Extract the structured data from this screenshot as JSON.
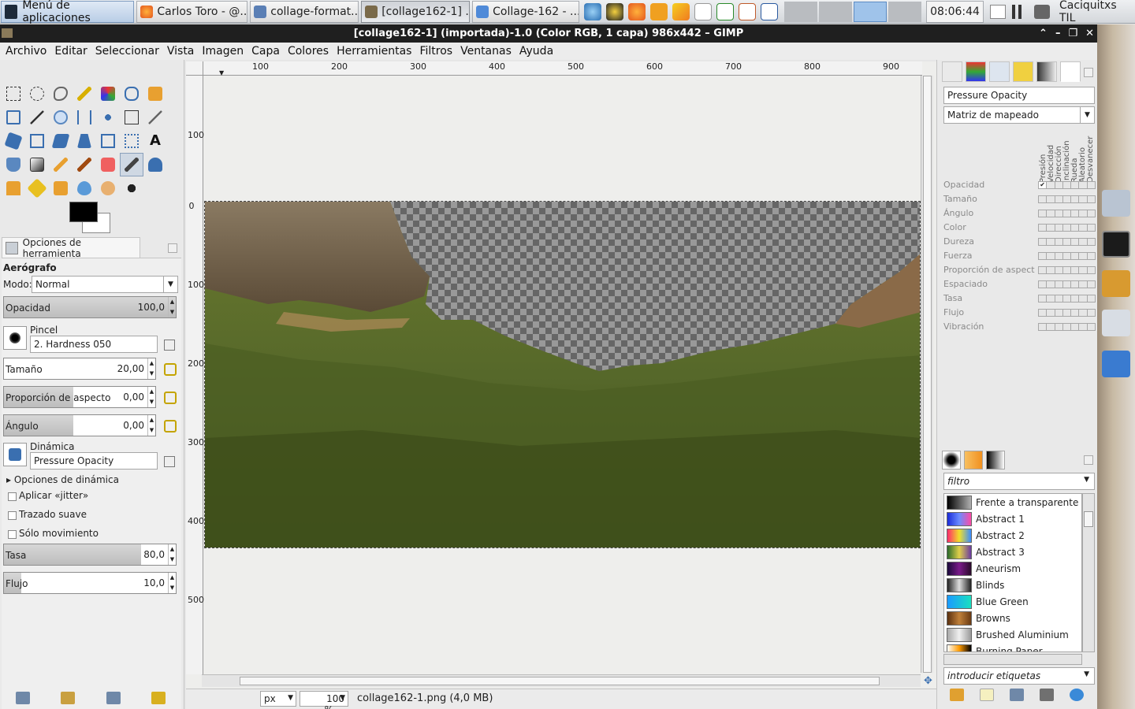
{
  "taskbar": {
    "menu_label": "Menú de aplicaciones",
    "tasks": [
      {
        "label": "Carlos Toro - @..."
      },
      {
        "label": "collage-format..."
      },
      {
        "label": "[collage162-1] ..."
      },
      {
        "label": "Collage-162 - ..."
      }
    ],
    "clock": "08:06:44",
    "user": "Caciquitxs TIL"
  },
  "window": {
    "title": "[collage162-1] (importada)-1.0 (Color RGB, 1 capa) 986x442 – GIMP"
  },
  "menubar": [
    "Archivo",
    "Editar",
    "Seleccionar",
    "Vista",
    "Imagen",
    "Capa",
    "Colores",
    "Herramientas",
    "Filtros",
    "Ventanas",
    "Ayuda"
  ],
  "tool_options": {
    "tab_label": "Opciones de herramienta",
    "tool_name": "Aerógrafo",
    "mode_label": "Modo:",
    "mode_value": "Normal",
    "opacity_label": "Opacidad",
    "opacity_value": "100,0",
    "brush_label": "Pincel",
    "brush_value": "2. Hardness 050",
    "size_label": "Tamaño",
    "size_value": "20,00",
    "aspect_label": "Proporción de aspecto",
    "aspect_value": "0,00",
    "angle_label": "Ángulo",
    "angle_value": "0,00",
    "dynamics_label": "Dinámica",
    "dynamics_value": "Pressure Opacity",
    "dynamics_options_label": "Opciones de dinámica",
    "jitter_label": "Aplicar «jitter»",
    "smooth_label": "Trazado suave",
    "motion_label": "Sólo movimiento",
    "rate_label": "Tasa",
    "rate_value": "80,0",
    "flow_label": "Flujo",
    "flow_value": "10,0"
  },
  "ruler": {
    "h_labels": [
      "100",
      "200",
      "300",
      "400",
      "500",
      "600",
      "700",
      "800",
      "900"
    ],
    "v_labels": [
      "100",
      "0",
      "100",
      "200",
      "300",
      "400",
      "500"
    ]
  },
  "statusbar": {
    "unit": "px",
    "zoom": "100 %",
    "message": "collage162-1.png (4,0 MB)"
  },
  "dynamics_editor": {
    "name": "Pressure Opacity",
    "mode": "Matriz de mapeado",
    "columns": [
      "Presión",
      "Velocidad",
      "Dirección",
      "Inclinación",
      "Rueda",
      "Aleatorio",
      "Desvanecer"
    ],
    "rows": [
      "Opacidad",
      "Tamaño",
      "Ángulo",
      "Color",
      "Dureza",
      "Fuerza",
      "Proporción de aspect",
      "Espaciado",
      "Tasa",
      "Flujo",
      "Vibración"
    ]
  },
  "gradients": {
    "filter_placeholder": "filtro",
    "tags_placeholder": "introducir etiquetas",
    "items": [
      {
        "name": "Frente a transparente",
        "colors": [
          "#000000",
          "#b0b0b0"
        ]
      },
      {
        "name": "Abstract 1",
        "colors": [
          "#1b2bd8",
          "#6a8cff",
          "#ff4aa5"
        ]
      },
      {
        "name": "Abstract 2",
        "colors": [
          "#ff2a6a",
          "#f0e02a",
          "#3a8cff"
        ]
      },
      {
        "name": "Abstract 3",
        "colors": [
          "#2a6a2a",
          "#e0d04a",
          "#6a3aa0"
        ]
      },
      {
        "name": "Aneurism",
        "colors": [
          "#1a0a3a",
          "#7a1a8a",
          "#2a0a2a"
        ]
      },
      {
        "name": "Blinds",
        "colors": [
          "#222222",
          "#dddddd",
          "#222222"
        ]
      },
      {
        "name": "Blue Green",
        "colors": [
          "#1a9aff",
          "#1ae0c0"
        ]
      },
      {
        "name": "Browns",
        "colors": [
          "#5a3010",
          "#c0803a",
          "#6a3a12"
        ]
      },
      {
        "name": "Brushed Aluminium",
        "colors": [
          "#a8a8a8",
          "#f0f0f0",
          "#9a9a9a"
        ]
      },
      {
        "name": "Burning Paper",
        "colors": [
          "#ffffff",
          "#ff9a00",
          "#000000"
        ]
      }
    ]
  }
}
